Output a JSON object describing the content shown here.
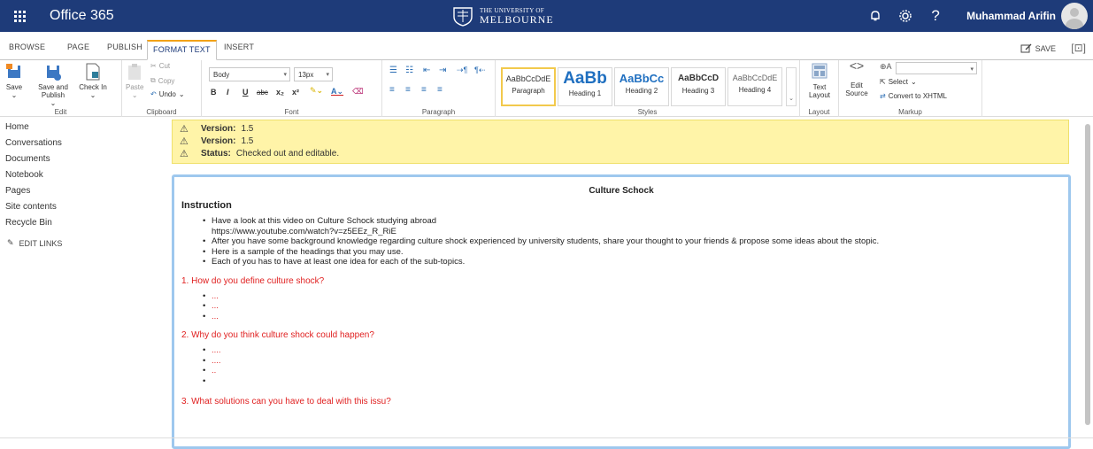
{
  "suite": {
    "app_name": "Office 365",
    "university_small": "THE UNIVERSITY OF",
    "university_big": "MELBOURNE",
    "user_name": "Muhammad Arifin",
    "icons": [
      "bell-icon",
      "gear-icon",
      "help-icon"
    ],
    "bar_color": "#1e3b79"
  },
  "tabs": {
    "browse": "BROWSE",
    "page": "PAGE",
    "publish": "PUBLISH",
    "format_text": "FORMAT TEXT",
    "insert": "INSERT",
    "save": "SAVE",
    "active": "FORMAT TEXT",
    "accent": "#f2a218"
  },
  "ribbon": {
    "edit": {
      "label": "Edit",
      "save": "Save",
      "save_publish": "Save and Publish",
      "check_in": "Check In"
    },
    "clipboard": {
      "label": "Clipboard",
      "paste": "Paste",
      "cut": "Cut",
      "copy": "Copy",
      "undo": "Undo"
    },
    "font": {
      "label": "Font",
      "font_name": "Body",
      "font_size": "13px",
      "bold": "B",
      "italic": "I",
      "underline": "U",
      "strike": "abc",
      "sub": "x₂",
      "sup": "x²"
    },
    "paragraph": {
      "label": "Paragraph"
    },
    "styles": {
      "label": "Styles",
      "items": [
        {
          "sample": "AaBbCcDdE",
          "name": "Paragraph"
        },
        {
          "sample": "AaBb",
          "name": "Heading 1"
        },
        {
          "sample": "AaBbCc",
          "name": "Heading 2"
        },
        {
          "sample": "AaBbCcD",
          "name": "Heading 3"
        },
        {
          "sample": "AaBbCcDdE",
          "name": "Heading 4"
        }
      ]
    },
    "layout": {
      "label": "Layout",
      "text_layout": "Text Layout"
    },
    "markup": {
      "label": "Markup",
      "edit_source": "Edit Source",
      "select": "Select",
      "convert": "Convert to XHTML"
    }
  },
  "nav": {
    "items": [
      "Home",
      "Conversations",
      "Documents",
      "Notebook",
      "Pages",
      "Site contents",
      "Recycle Bin"
    ],
    "edit_links": "EDIT LINKS"
  },
  "status": {
    "lines": [
      {
        "label": "Version:",
        "value": "1.5"
      },
      {
        "label": "Version:",
        "value": "1.5"
      },
      {
        "label": "Status:",
        "value": "Checked out and editable."
      }
    ],
    "bg": "#fff4a8"
  },
  "doc": {
    "title": "Culture Schock",
    "heading": "Instruction",
    "bullets": [
      "Have a look at this video on Culture Schock studying abroad",
      "After you have some background knowledge regarding culture shock experienced by university students, share your thought to your friends & propose some ideas about the stopic.",
      "Here is a sample of the headings that you may use.",
      "Each of you has to have at least one idea for each of the sub-topics."
    ],
    "video_url": "https://www.youtube.com/watch?v=z5EEz_R_RiE",
    "q1": "1. How do you define culture shock?",
    "q1_items": [
      "...",
      "...",
      "..."
    ],
    "q2": "2. Why do you think culture shock could happen?",
    "q2_items": [
      "....",
      "....",
      "..",
      ""
    ],
    "q3": "3. What solutions can you have to deal with this issu?",
    "question_color": "#e02020"
  }
}
